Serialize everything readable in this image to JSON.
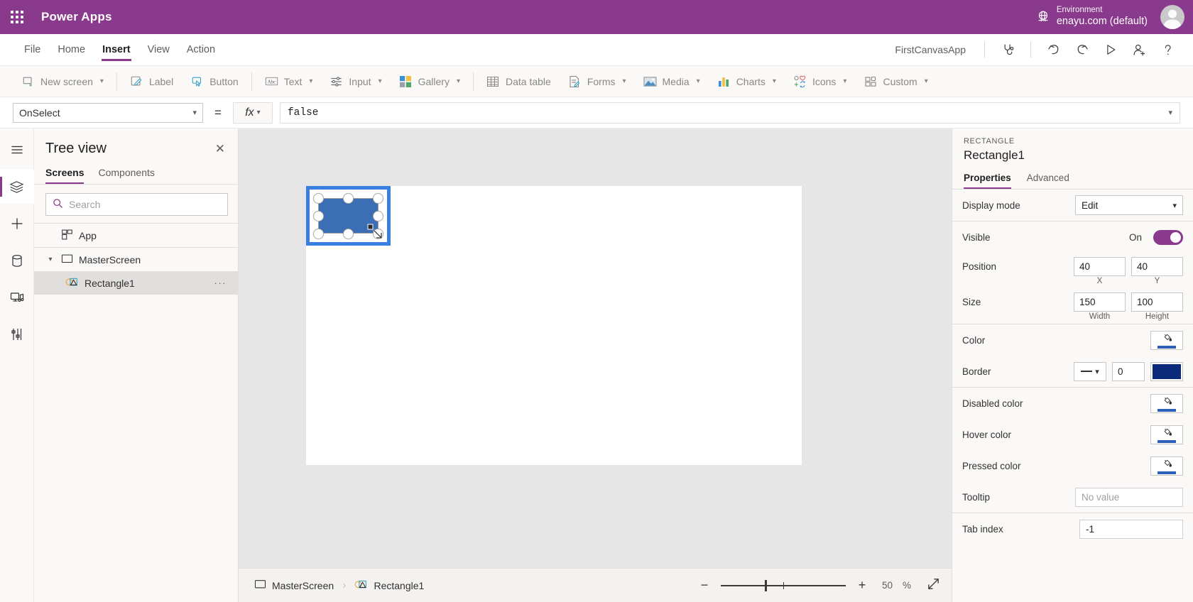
{
  "topbar": {
    "waffle_icon": "app-launcher-icon",
    "brand": "Power Apps",
    "globe_icon": "globe-icon",
    "environment_label": "Environment",
    "environment_value": "enayu.com (default)",
    "avatar": "user-avatar",
    "accent": "#8a3a8d"
  },
  "menubar": {
    "items": [
      {
        "label": "File",
        "active": false
      },
      {
        "label": "Home",
        "active": false
      },
      {
        "label": "Insert",
        "active": true
      },
      {
        "label": "View",
        "active": false
      },
      {
        "label": "Action",
        "active": false
      }
    ],
    "app_name": "FirstCanvasApp",
    "icons": [
      {
        "name": "app-checker-icon",
        "title": "App checker"
      },
      {
        "name": "undo-icon",
        "title": "Undo"
      },
      {
        "name": "redo-icon",
        "title": "Redo"
      },
      {
        "name": "play-icon",
        "title": "Preview the app"
      },
      {
        "name": "share-icon",
        "title": "Share"
      },
      {
        "name": "help-icon",
        "title": "Help"
      }
    ]
  },
  "ribbon": {
    "items": [
      {
        "label": "New screen",
        "icon": "new-screen-icon",
        "caret": true
      },
      {
        "label": "Label",
        "icon": "label-icon",
        "caret": false
      },
      {
        "label": "Button",
        "icon": "button-icon",
        "caret": false
      },
      {
        "label": "Text",
        "icon": "text-icon",
        "caret": true
      },
      {
        "label": "Input",
        "icon": "input-icon",
        "caret": true
      },
      {
        "label": "Gallery",
        "icon": "gallery-icon",
        "caret": true
      },
      {
        "label": "Data table",
        "icon": "data-table-icon",
        "caret": false
      },
      {
        "label": "Forms",
        "icon": "forms-icon",
        "caret": true
      },
      {
        "label": "Media",
        "icon": "media-icon",
        "caret": true
      },
      {
        "label": "Charts",
        "icon": "charts-icon",
        "caret": true
      },
      {
        "label": "Icons",
        "icon": "icons-icon",
        "caret": true
      },
      {
        "label": "Custom",
        "icon": "custom-icon",
        "caret": true
      }
    ]
  },
  "formulabar": {
    "property": "OnSelect",
    "equals": "=",
    "fx_label": "fx",
    "formula": "false"
  },
  "rail": {
    "items": [
      {
        "name": "hamburger-icon",
        "active": false
      },
      {
        "name": "tree-view-icon",
        "active": true
      },
      {
        "name": "insert-icon",
        "active": false
      },
      {
        "name": "data-icon",
        "active": false
      },
      {
        "name": "media-library-icon",
        "active": false
      },
      {
        "name": "advanced-tools-icon",
        "active": false
      }
    ]
  },
  "treeview": {
    "title": "Tree view",
    "close_icon": "close-icon",
    "tabs": [
      {
        "label": "Screens",
        "active": true
      },
      {
        "label": "Components",
        "active": false
      }
    ],
    "search_placeholder": "Search",
    "app_item": "App",
    "nodes": [
      {
        "label": "MasterScreen",
        "icon": "screen-icon",
        "expanded": true,
        "selected": false,
        "indent": false
      },
      {
        "label": "Rectangle1",
        "icon": "rectangle-shape-icon",
        "expanded": false,
        "selected": true,
        "indent": true,
        "overflow": "···"
      }
    ]
  },
  "canvas": {
    "selection_name": "Rectangle1",
    "shape_fill": "#3b6eb5",
    "selection_outline": "#3a7fe0",
    "background": "#e6e6e6",
    "screen_background": "#ffffff"
  },
  "statusbar": {
    "breadcrumb": [
      {
        "label": "MasterScreen",
        "icon": "screen-icon"
      },
      {
        "label": "Rectangle1",
        "icon": "rectangle-shape-icon"
      }
    ],
    "zoom_out": "−",
    "zoom_in": "+",
    "zoom_value": "50",
    "zoom_unit": "%",
    "expand_icon": "fit-screen-icon"
  },
  "properties": {
    "kind": "RECTANGLE",
    "name": "Rectangle1",
    "tabs": [
      {
        "label": "Properties",
        "active": true
      },
      {
        "label": "Advanced",
        "active": false
      }
    ],
    "display_mode": {
      "label": "Display mode",
      "value": "Edit"
    },
    "visible": {
      "label": "Visible",
      "state": "On"
    },
    "position": {
      "label": "Position",
      "x": "40",
      "y": "40",
      "x_sub": "X",
      "y_sub": "Y"
    },
    "size": {
      "label": "Size",
      "width": "150",
      "height": "100",
      "w_sub": "Width",
      "h_sub": "Height"
    },
    "color": {
      "label": "Color",
      "icon": "fill-bucket-icon",
      "swatch": "#2b5fb8"
    },
    "border": {
      "label": "Border",
      "style": "—",
      "width": "0",
      "swatch": "#0b2a7a"
    },
    "disabled_color": {
      "label": "Disabled color",
      "icon": "fill-bucket-icon",
      "swatch": "#2b5fb8"
    },
    "hover_color": {
      "label": "Hover color",
      "icon": "fill-bucket-icon",
      "swatch": "#2b5fb8"
    },
    "pressed_color": {
      "label": "Pressed color",
      "icon": "fill-bucket-icon",
      "swatch": "#2b5fb8"
    },
    "tooltip": {
      "label": "Tooltip",
      "placeholder": "No value",
      "value": ""
    },
    "tab_index": {
      "label": "Tab index",
      "value": "-1"
    }
  }
}
